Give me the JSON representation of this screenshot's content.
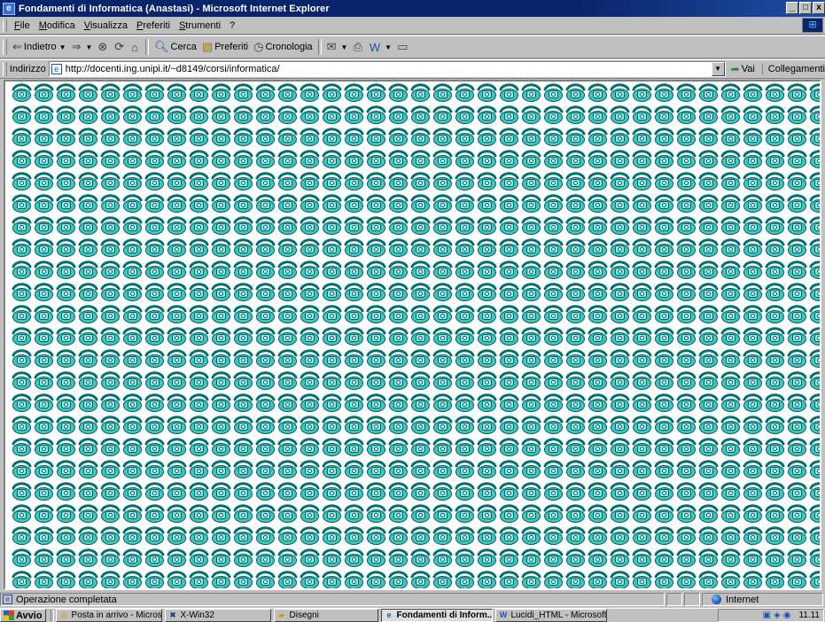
{
  "window": {
    "title": "Fondamenti di Informatica (Anastasi) - Microsoft Internet Explorer",
    "controls": [
      "_",
      "□",
      "x"
    ]
  },
  "menu": [
    "File",
    "Modifica",
    "Visualizza",
    "Preferiti",
    "Strumenti",
    "?"
  ],
  "toolbar": {
    "back_label": "Indietro",
    "search_label": "Cerca",
    "favorites_label": "Preferiti",
    "history_label": "Cronologia"
  },
  "address": {
    "label": "Indirizzo",
    "url": "http://docenti.ing.unipi.it/~d8149/corsi/informatica/",
    "go_label": "Vai",
    "links_label": "Collegamenti"
  },
  "content": {
    "background_tile": "telephone-icon",
    "tile_color": "#40c8c0"
  },
  "status": {
    "text": "Operazione completata",
    "zone": "Internet"
  },
  "taskbar": {
    "start_label": "Avvio",
    "tasks": [
      {
        "label": "Posta in arrivo - Microsoft ...",
        "icon": "outlook-icon",
        "active": false
      },
      {
        "label": "X-Win32",
        "icon": "xwin-icon",
        "active": false
      },
      {
        "label": "Disegni",
        "icon": "folder-icon",
        "active": false
      },
      {
        "label": "Fondamenti di Inform...",
        "icon": "ie-icon",
        "active": true
      },
      {
        "label": "Lucidi_HTML - Microsoft ...",
        "icon": "word-icon",
        "active": false
      }
    ],
    "clock": "11.11"
  }
}
